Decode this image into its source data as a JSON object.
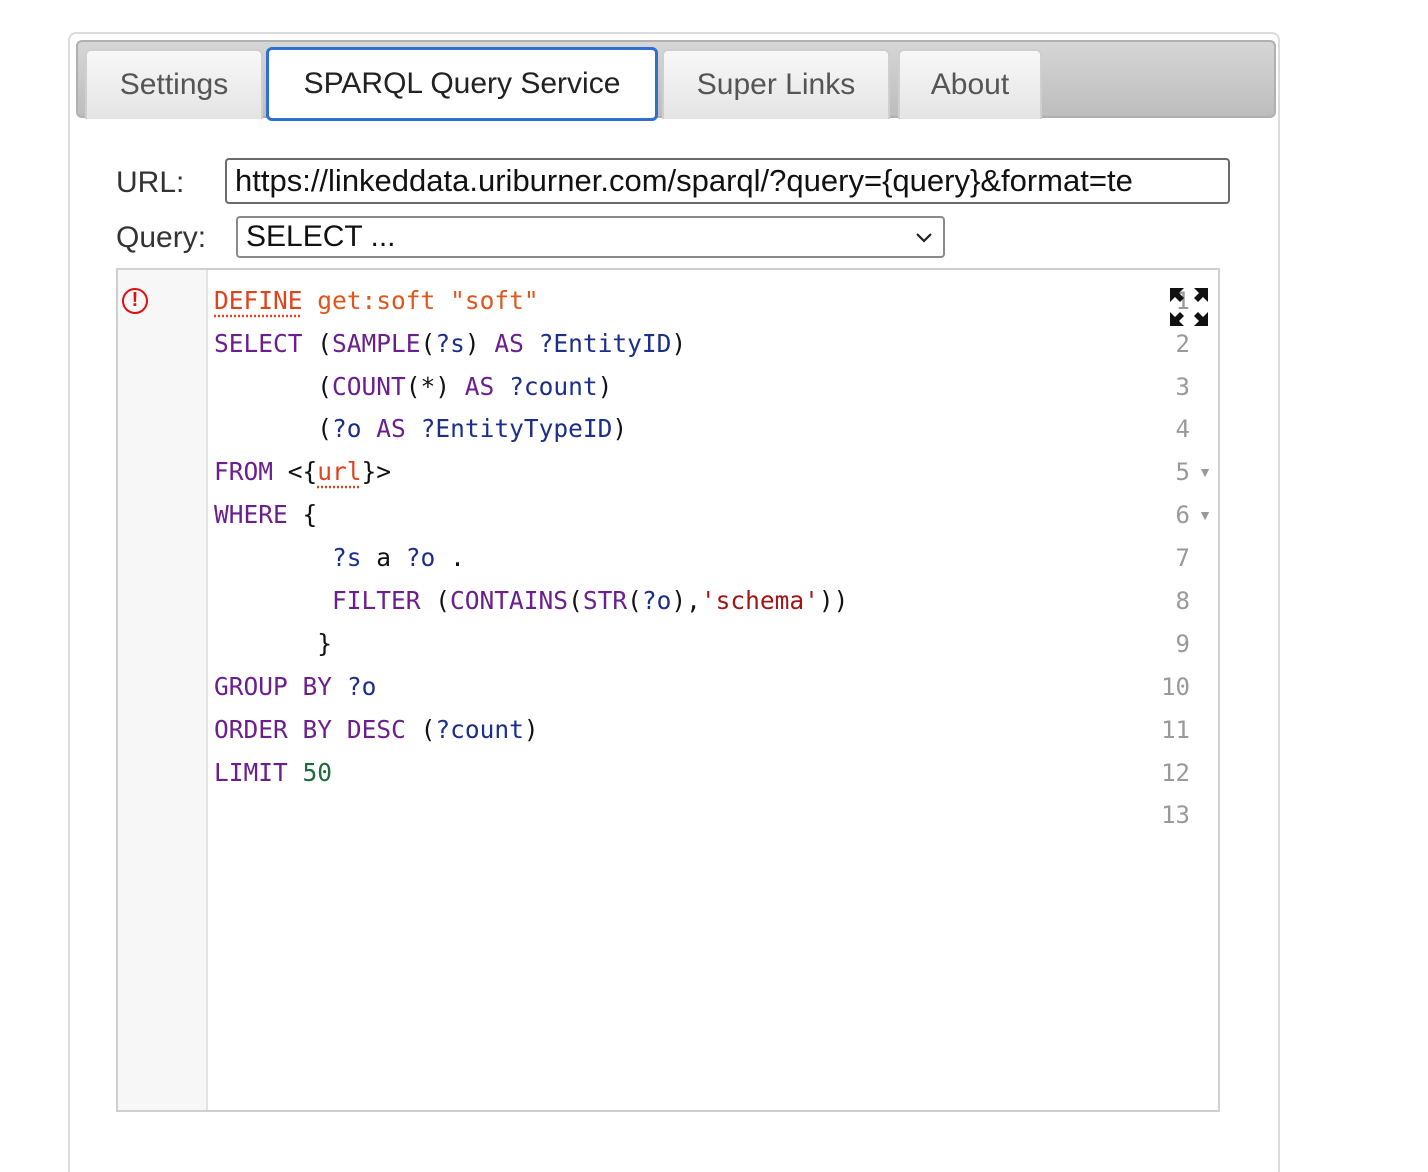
{
  "tabs": [
    {
      "label": "Settings"
    },
    {
      "label": "SPARQL Query Service"
    },
    {
      "label": "Super Links"
    },
    {
      "label": "About"
    }
  ],
  "form": {
    "url_label": "URL:",
    "url_value": "https://linkeddata.uriburner.com/sparql/?query={query}&format=te",
    "query_label": "Query:",
    "query_selected": "SELECT ..."
  },
  "editor": {
    "line_numbers": [
      "1",
      "2",
      "3",
      "4",
      "5",
      "6",
      "7",
      "8",
      "9",
      "10",
      "11",
      "12",
      "13"
    ],
    "error_marker": "!",
    "fold_marker": "▼",
    "expand_icon": "expand-icon"
  }
}
